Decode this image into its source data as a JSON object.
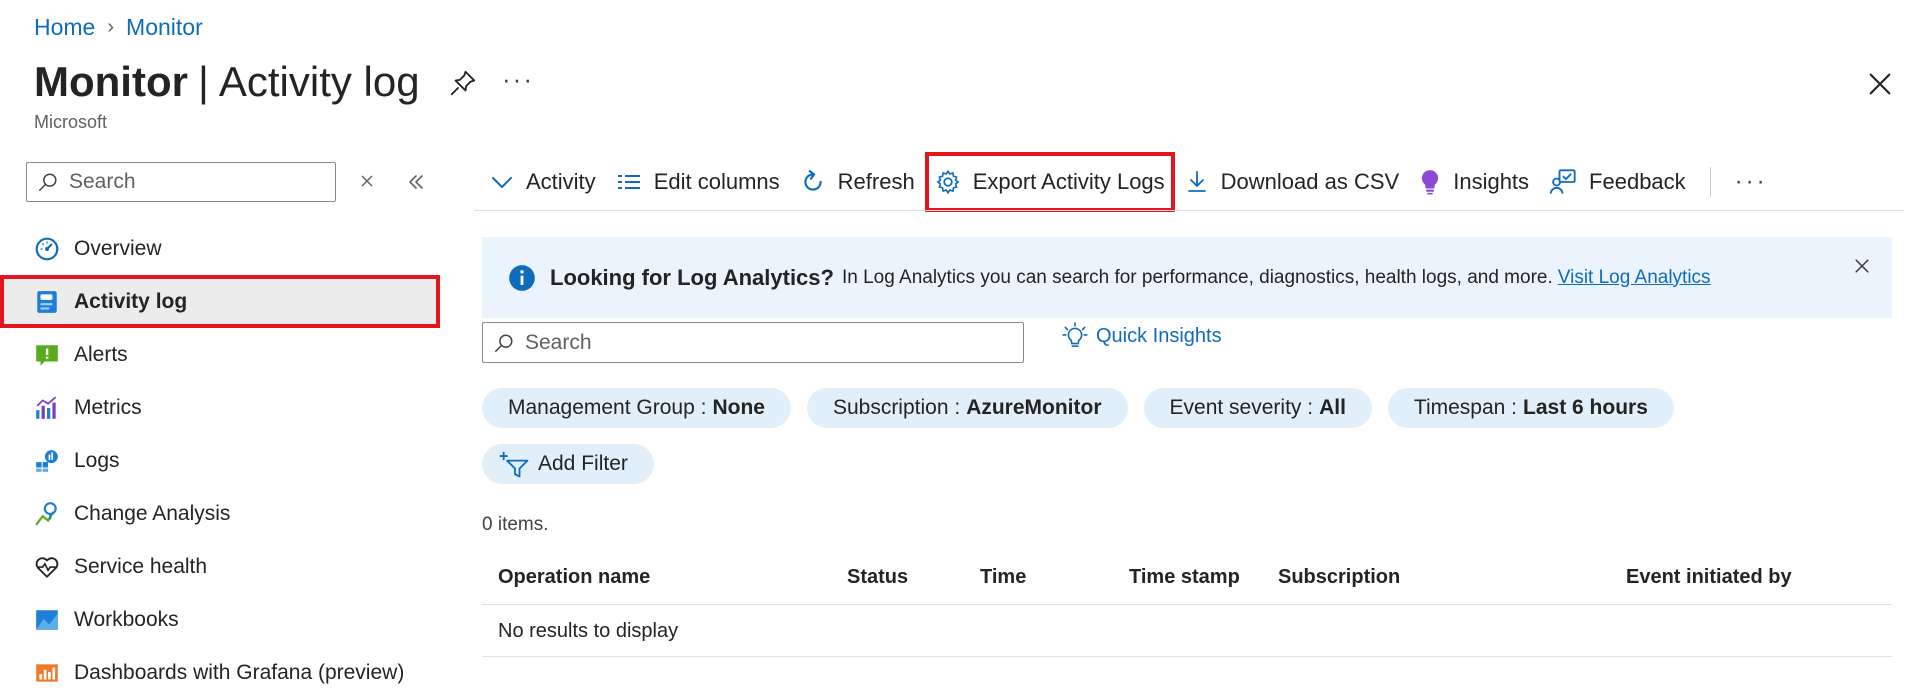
{
  "breadcrumb": {
    "home": "Home",
    "current": "Monitor"
  },
  "header": {
    "title_bold": "Monitor",
    "title_separator": "|",
    "title_rest": "Activity log",
    "subtitle": "Microsoft",
    "more": "···"
  },
  "sidebar": {
    "search_placeholder": "Search",
    "items": [
      {
        "label": "Overview"
      },
      {
        "label": "Activity log"
      },
      {
        "label": "Alerts"
      },
      {
        "label": "Metrics"
      },
      {
        "label": "Logs"
      },
      {
        "label": "Change Analysis"
      },
      {
        "label": "Service health"
      },
      {
        "label": "Workbooks"
      },
      {
        "label": "Dashboards with Grafana (preview)"
      }
    ]
  },
  "toolbar": {
    "activity": "Activity",
    "edit_columns": "Edit columns",
    "refresh": "Refresh",
    "export": "Export Activity Logs",
    "download": "Download as CSV",
    "insights": "Insights",
    "feedback": "Feedback",
    "more": "···"
  },
  "banner": {
    "title": "Looking for Log Analytics?",
    "text": "In Log Analytics you can search for performance, diagnostics, health logs, and more.",
    "link": "Visit Log Analytics"
  },
  "main": {
    "search_placeholder": "Search",
    "quick_insights": "Quick Insights",
    "filters": [
      {
        "key": "Management Group :",
        "value": "None"
      },
      {
        "key": "Subscription :",
        "value": "AzureMonitor"
      },
      {
        "key": "Event severity :",
        "value": "All"
      },
      {
        "key": "Timespan :",
        "value": "Last 6 hours"
      }
    ],
    "add_filter": "Add Filter",
    "count": "0 items.",
    "columns": [
      "Operation name",
      "Status",
      "Time",
      "Time stamp",
      "Subscription",
      "Event initiated by"
    ],
    "empty": "No results to display"
  },
  "colors": {
    "accent": "#0f6cbd",
    "highlight": "#e3161f",
    "banner_bg": "#ebf3fc",
    "pill_bg": "#e1effb"
  }
}
